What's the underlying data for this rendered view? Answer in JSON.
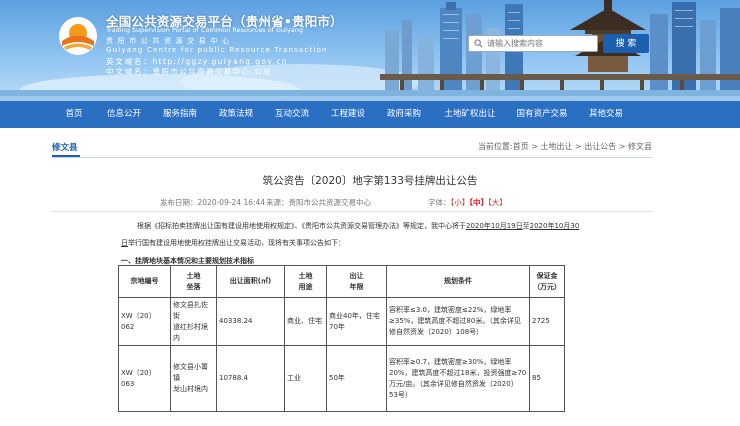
{
  "header": {
    "site_title": "全国公共资源交易平台（贵州省•贵阳市）",
    "site_subtitle": "Trading Supervision Portal of Common Resources of Guiyang",
    "cn_line": "贵阳市公共资源交易中心",
    "en_line": "Guiyang Centre for public Resource Transaction",
    "en_domain_label": "英文域名：",
    "en_domain_value": "http://ggzy.guiyang.gov.cn",
    "cn_domain_label": "中文域名：",
    "cn_domain_value": "贵阳市公共资源交易中心.公益",
    "search_placeholder": "请输入搜索内容",
    "search_button": "搜 索"
  },
  "nav": [
    "首页",
    "信息公开",
    "服务指南",
    "政策法规",
    "互动交流",
    "工程建设",
    "政府采购",
    "土地矿权出让",
    "国有资产交易",
    "其他交易"
  ],
  "breadcrumb": {
    "district": "修文县",
    "path": "当前位置:首页 > 土地出让 > 出让公告 > 修文县"
  },
  "article": {
    "title": "筑公资告〔2020〕地字第133号挂牌出让公告",
    "publish_date": "发布日期：2020-09-24 16:44",
    "source": "来源：贵阳市公共资源交易中心",
    "font_label": "字体：",
    "font_small": "【小】",
    "font_medium": "【中】",
    "font_large": "【大】",
    "para1_a": "根据《招标拍卖挂牌出让国有建设用地使用权规定》、《贵阳市公共资源交易管理办法》等规定，我中心将于",
    "para1_date1": "2020年10月19日",
    "para1_to": "至",
    "para1_date2": "2020年10月30",
    "para2_date": "日",
    "para2_rest": "举行国有建设用地使用权挂牌出让交易活动，现将有关事项公告如下：",
    "section1": "一、挂牌地块基本情况和主要规划技术指标"
  },
  "table": {
    "headers": {
      "parcel_no": "宗地编号",
      "location": [
        "土地",
        "坐落"
      ],
      "area": "出让面积(㎡)",
      "use": [
        "土地",
        "用途"
      ],
      "term": [
        "出让",
        "年限"
      ],
      "conditions": "规划条件",
      "deposit": [
        "保证金",
        "（万元）"
      ]
    },
    "rows": [
      {
        "parcel_no": "XW〔20〕062",
        "location": [
          "修文县扎佐街",
          "道红杉村境内"
        ],
        "area": "40338.24",
        "use": "商业、住宅",
        "term": "商业40年，住宅70年",
        "conditions": [
          "容积率≤3.0，建筑密度≤22%，绿地率",
          "≥35%，建筑高度不超过80米。（其余详见",
          "修自然资发〔2020〕108号）"
        ],
        "deposit": "2725"
      },
      {
        "parcel_no": "XW〔20〕063",
        "location": [
          "修文县小箐镇",
          "龙山村境内"
        ],
        "area": "10788.4",
        "use": "工业",
        "term": "50年",
        "conditions": [
          "容积率≥0.7，建筑密度≥30%，绿地率",
          "20%，建筑高度不超过18米，投资强度≥70",
          "万元/亩。（其余详见修自然资发〔2020〕",
          "53号）"
        ],
        "deposit": "85"
      }
    ]
  }
}
